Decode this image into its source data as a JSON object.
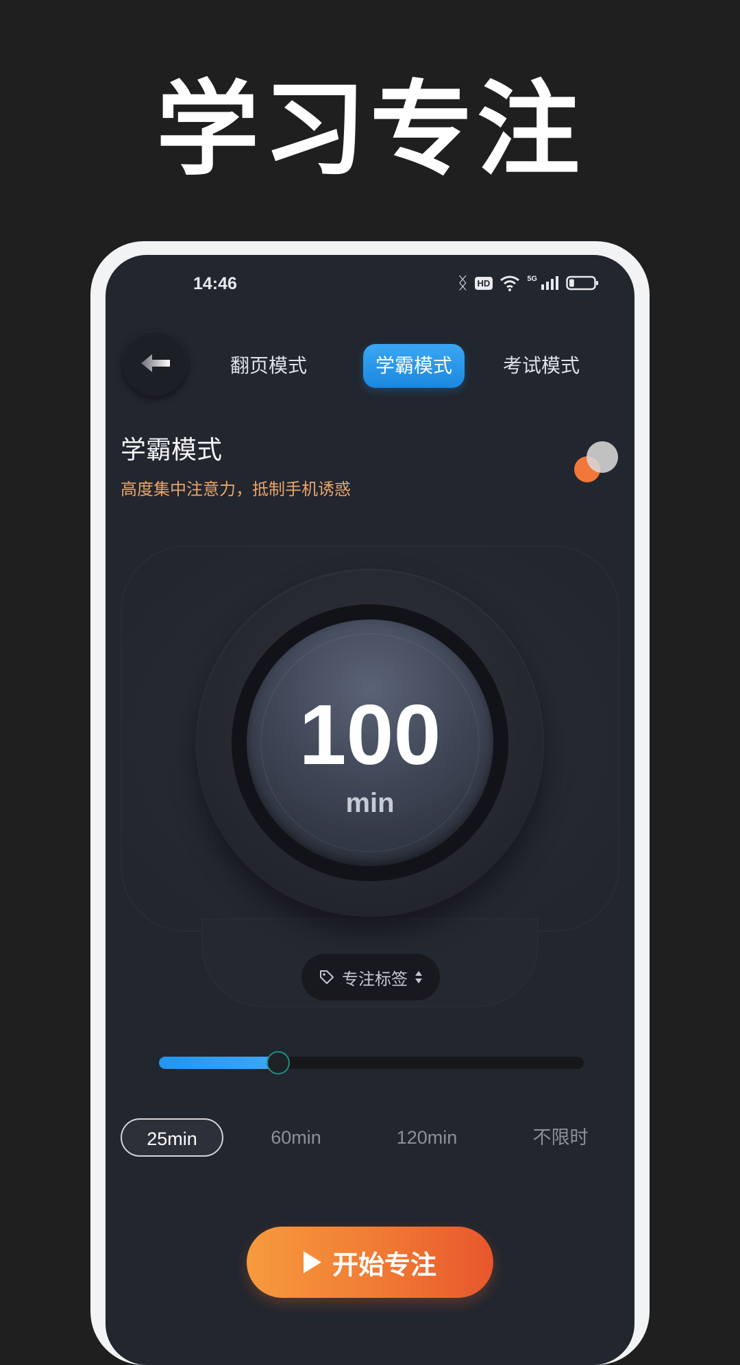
{
  "promo": {
    "title": "学习专注"
  },
  "status_bar": {
    "time": "14:46",
    "hd_badge": "HD",
    "signal_label": "5G",
    "icons": [
      "bluetooth-icon",
      "hd-icon",
      "wifi-icon",
      "signal-icon",
      "battery-icon"
    ],
    "battery_level": 0.2
  },
  "nav": {
    "back_icon": "back-arrow-icon",
    "tabs": [
      {
        "label": "翻页模式",
        "active": false
      },
      {
        "label": "学霸模式",
        "active": true
      },
      {
        "label": "考试模式",
        "active": false
      }
    ]
  },
  "mode": {
    "title": "学霸模式",
    "description": "高度集中注意力，抵制手机诱惑"
  },
  "timer": {
    "value": "100",
    "unit": "min"
  },
  "tag": {
    "label": "专注标签",
    "icon": "tag-icon"
  },
  "slider": {
    "level": 0.28
  },
  "durations": [
    {
      "label": "25min",
      "selected": true
    },
    {
      "label": "60min",
      "selected": false
    },
    {
      "label": "120min",
      "selected": false
    },
    {
      "label": "不限时",
      "selected": false
    }
  ],
  "start_button": {
    "label": "开始专注",
    "icon": "play-icon"
  },
  "colors": {
    "background": "#1f1f20",
    "screen": "#22262e",
    "accent_blue": "#2394f0",
    "accent_orange": "#f07a34",
    "desc_orange": "#e9a46a"
  }
}
